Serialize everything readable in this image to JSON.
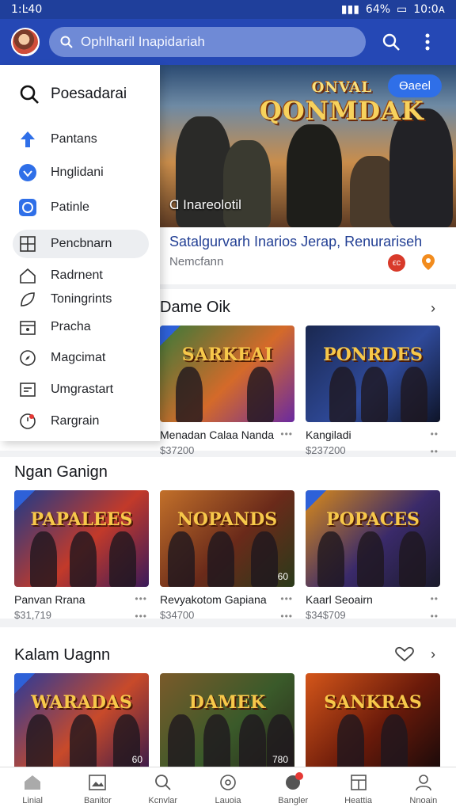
{
  "status_bar": {
    "time": "1:Ŀ40",
    "clock": "10:0ᴀ",
    "battery": "64%"
  },
  "app_bar": {
    "search_placeholder": "Ophlharil Inapidariah"
  },
  "drawer": {
    "header": "Poesadarai",
    "items": [
      {
        "label": "Pantans",
        "icon": "arrow-up-icon",
        "color": "#2f6fe8"
      },
      {
        "label": "Hnglidani",
        "icon": "badge-icon",
        "color": "#2f6fe8"
      },
      {
        "label": "Patinle",
        "icon": "circle-square-icon",
        "color": "#2f6fe8"
      },
      {
        "label": "Pencbnarn",
        "icon": "grid-icon",
        "color": "#333333",
        "active": true
      },
      {
        "label": "Radrnent",
        "icon": "home-icon",
        "color": "#333333"
      },
      {
        "label": "Toningrints",
        "icon": "leaf-icon",
        "color": "#333333"
      },
      {
        "label": "Pracha",
        "icon": "calendar-icon",
        "color": "#333333"
      },
      {
        "label": "Magcimat",
        "icon": "compass-icon",
        "color": "#333333"
      },
      {
        "label": "Umgrastart",
        "icon": "card-icon",
        "color": "#333333"
      },
      {
        "label": "Rargrain",
        "icon": "clock-icon",
        "color": "#333333"
      }
    ]
  },
  "hero": {
    "title": "ONVAL",
    "title2": "QONMDAK",
    "badge": "Ɵaeel",
    "caption": "Ɑ Inareolotil",
    "info_title": "Satalgurvarh Inarios Jerap, Renurariseh",
    "info_subtitle": "Nemcfann",
    "red_badge": "ϵc"
  },
  "section1": {
    "title": "Dame Oik",
    "cards": [
      {
        "name": "Menadan Calaa Nanda",
        "price": "$37200",
        "logo": "SARKEAI",
        "colors": [
          "#3a7a3a",
          "#d46a2a",
          "#6a2aa0"
        ]
      },
      {
        "name": "Kangiladi",
        "price": "$237200",
        "logo": "PONRDES",
        "colors": [
          "#1a2850",
          "#2f4a9a",
          "#0e1428"
        ]
      }
    ]
  },
  "section2": {
    "title": "Ngan Ganign",
    "cards": [
      {
        "name": "Panvan Rrana",
        "price": "$31,719",
        "logo": "PAPALEES",
        "colors": [
          "#1d3a8a",
          "#c23a2a",
          "#3a1a5a"
        ]
      },
      {
        "name": "Revyakotom Gapiana",
        "price": "$34700",
        "logo": "NOPANDS",
        "colors": [
          "#c2702a",
          "#6a2a1a",
          "#2a3a1a"
        ],
        "num": "60"
      },
      {
        "name": "Kaarl Seoairn",
        "price": "$34$709",
        "logo": "POPACES",
        "colors": [
          "#d88a1a",
          "#3a2a6a",
          "#1a1a2a"
        ]
      }
    ]
  },
  "section3": {
    "title": "Kalam Uagnn",
    "cards": [
      {
        "logo": "WARADAS",
        "colors": [
          "#2a3a9a",
          "#c84a2a",
          "#3a1a4a"
        ],
        "num": "60"
      },
      {
        "logo": "DAMEK",
        "colors": [
          "#7a5a2a",
          "#3a5a2a",
          "#2a2a1a"
        ],
        "num": "780"
      },
      {
        "logo": "SANKRAS",
        "colors": [
          "#d4561a",
          "#6a1a0a",
          "#1a0a0a"
        ]
      }
    ]
  },
  "bottom_nav": [
    {
      "label": "Linial",
      "icon": "home-icon"
    },
    {
      "label": "Banitor",
      "icon": "image-icon"
    },
    {
      "label": "Kcnvlar",
      "icon": "search-icon"
    },
    {
      "label": "Lauoia",
      "icon": "settings-icon"
    },
    {
      "label": "Bangler",
      "icon": "chat-icon",
      "dot": true
    },
    {
      "label": "Heattia",
      "icon": "calendar-icon"
    },
    {
      "label": "Nnoain",
      "icon": "profile-icon"
    }
  ]
}
